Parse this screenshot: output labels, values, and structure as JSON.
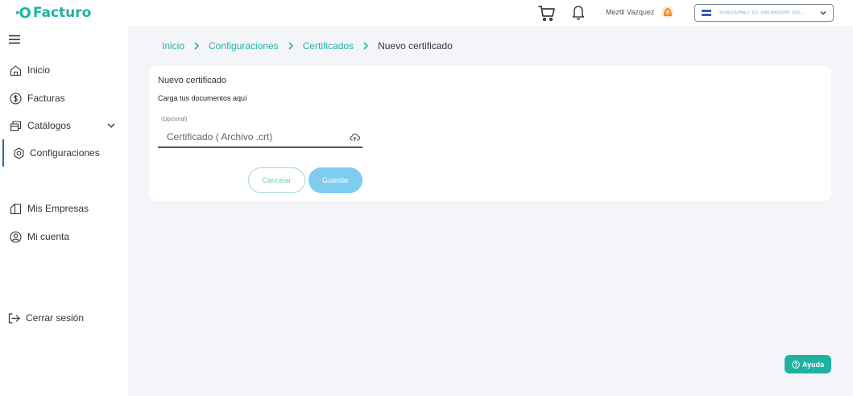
{
  "app": {
    "logo_mark": "ꞏO",
    "logo_text": "Facturo",
    "brand_color": "#20b2a6"
  },
  "header": {
    "user_name": "Meztli Vazquez",
    "company_name": "SOEDONET EL SALVADOR SO...",
    "icons": [
      "cart-icon",
      "bell-icon",
      "avatar",
      "flag-icon",
      "chevron-down-icon"
    ]
  },
  "sidebar": {
    "items": [
      {
        "label": "Inicio",
        "icon": "home-icon"
      },
      {
        "label": "Facturas",
        "icon": "dollar-icon"
      },
      {
        "label": "Catálogos",
        "icon": "catalog-icon"
      },
      {
        "label": "Configuraciones",
        "icon": "gear-icon",
        "active": true
      },
      {
        "label": "Mis Empresas",
        "icon": "building-icon"
      },
      {
        "label": "Mi cuenta",
        "icon": "user-icon"
      },
      {
        "label": "Cerrar sesión",
        "icon": "logout-icon"
      }
    ]
  },
  "breadcrumb": {
    "items": [
      "Inicio",
      "Configuraciones",
      "Certificados"
    ],
    "current": "Nuevo certificado"
  },
  "form": {
    "title": "Nuevo certificado",
    "subtitle": "Carga tus documentos aquí",
    "field_label": "(Opcional)",
    "field_placeholder": "Certificado ( Archivo .crt)",
    "cancel_label": "Cancelar",
    "save_label": "Guardar"
  },
  "help": {
    "label": "Ayuda"
  }
}
